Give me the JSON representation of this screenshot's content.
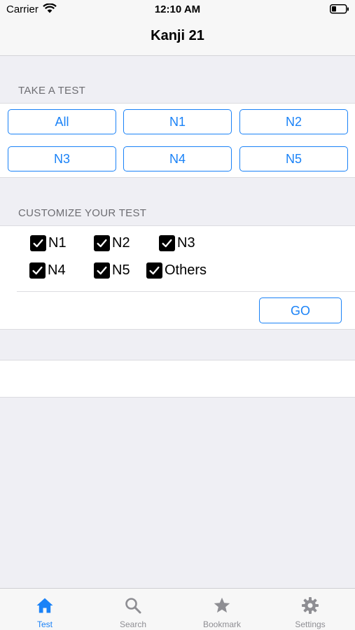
{
  "status_bar": {
    "carrier": "Carrier",
    "time": "12:10 AM"
  },
  "nav": {
    "title": "Kanji 21"
  },
  "take_test": {
    "header": "TAKE A TEST",
    "buttons": [
      "All",
      "N1",
      "N2",
      "N3",
      "N4",
      "N5"
    ]
  },
  "customize": {
    "header": "CUSTOMIZE YOUR TEST",
    "options": [
      {
        "label": "N1",
        "checked": true
      },
      {
        "label": "N2",
        "checked": true
      },
      {
        "label": "N3",
        "checked": true
      },
      {
        "label": "N4",
        "checked": true
      },
      {
        "label": "N5",
        "checked": true
      },
      {
        "label": "Others",
        "checked": true
      }
    ],
    "go_label": "GO"
  },
  "tabbar": {
    "tabs": [
      {
        "label": "Test",
        "icon": "home-icon",
        "active": true
      },
      {
        "label": "Search",
        "icon": "search-icon",
        "active": false
      },
      {
        "label": "Bookmark",
        "icon": "star-icon",
        "active": false
      },
      {
        "label": "Settings",
        "icon": "gear-icon",
        "active": false
      }
    ]
  },
  "colors": {
    "accent": "#1a82f7",
    "background": "#efeff4",
    "inactive_tab": "#8e8e93"
  }
}
